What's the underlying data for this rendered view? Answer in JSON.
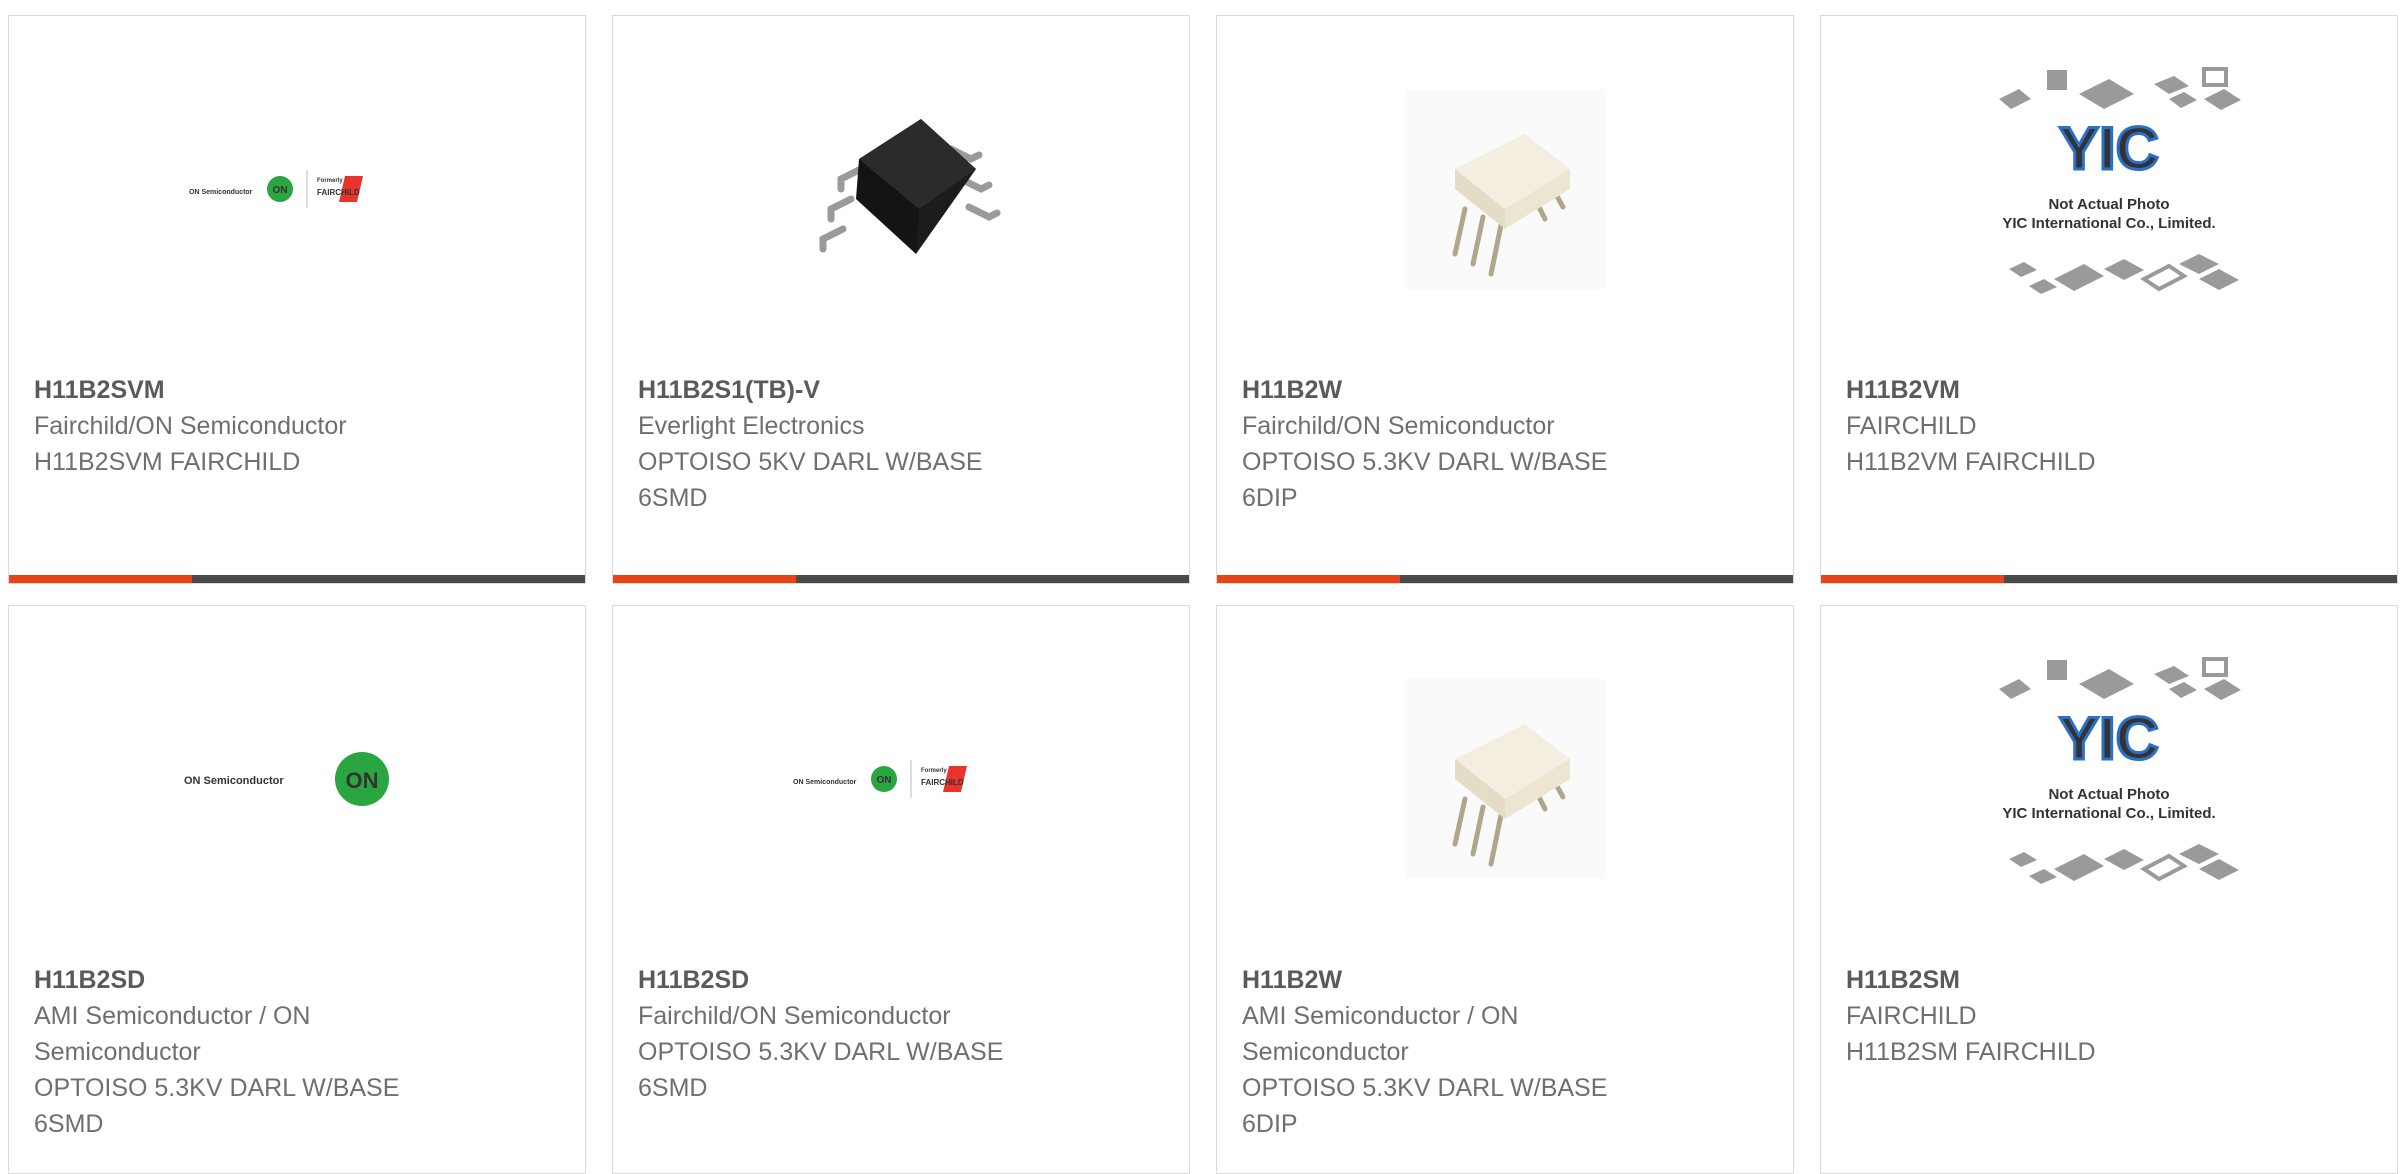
{
  "colors": {
    "accent": "#e8441a",
    "bar": "#4a4a4a",
    "border": "#d9d9d9",
    "on_green": "#2aa640",
    "fairchild_red": "#e8342c"
  },
  "logos": {
    "on_semi_small": "ON Semiconductor",
    "on_mark": "ON",
    "formerly": "Formerly",
    "fairchild": "FAIRCHILD",
    "yic_mark": "YIC",
    "yic_caption_1": "Not Actual Photo",
    "yic_caption_2": "YIC International Co., Limited."
  },
  "products": [
    {
      "part": "H11B2SVM",
      "maker": "Fairchild/ON Semiconductor",
      "desc": [
        "H11B2SVM FAIRCHILD"
      ],
      "image": "on-fairchild-logo"
    },
    {
      "part": "H11B2S1(TB)-V",
      "maker": "Everlight Electronics",
      "desc": [
        "OPTOISO 5KV DARL W/BASE",
        "6SMD"
      ],
      "image": "smd-package-photo"
    },
    {
      "part": "H11B2W",
      "maker": "Fairchild/ON Semiconductor",
      "desc": [
        "OPTOISO 5.3KV DARL W/BASE",
        "6DIP"
      ],
      "image": "dip-package-photo"
    },
    {
      "part": "H11B2VM",
      "maker": "FAIRCHILD",
      "desc": [
        "H11B2VM FAIRCHILD"
      ],
      "image": "yic-placeholder"
    },
    {
      "part": "H11B2SD",
      "maker": "AMI Semiconductor / ON",
      "desc": [
        "Semiconductor",
        "OPTOISO 5.3KV DARL W/BASE",
        "6SMD"
      ],
      "image": "on-semiconductor-logo"
    },
    {
      "part": "H11B2SD",
      "maker": "Fairchild/ON Semiconductor",
      "desc": [
        "OPTOISO 5.3KV DARL W/BASE",
        "6SMD"
      ],
      "image": "on-fairchild-logo"
    },
    {
      "part": "H11B2W",
      "maker": "AMI Semiconductor / ON",
      "desc": [
        "Semiconductor",
        "OPTOISO 5.3KV DARL W/BASE",
        "6DIP"
      ],
      "image": "dip-package-photo"
    },
    {
      "part": "H11B2SM",
      "maker": "FAIRCHILD",
      "desc": [
        "H11B2SM FAIRCHILD"
      ],
      "image": "yic-placeholder"
    }
  ]
}
